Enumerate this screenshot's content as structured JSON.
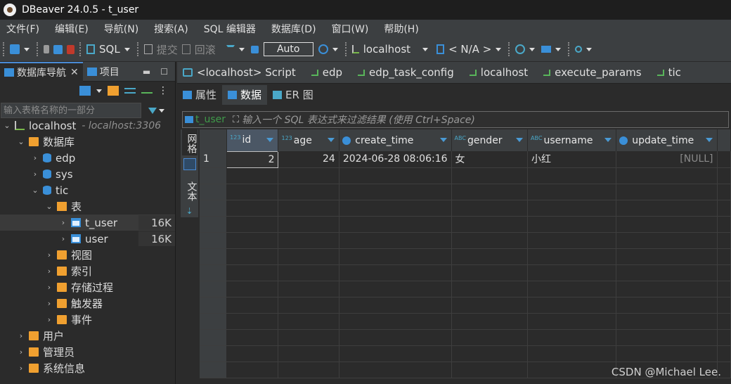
{
  "window": {
    "title": "DBeaver 24.0.5 - t_user"
  },
  "menu": [
    "文件(F)",
    "编辑(E)",
    "导航(N)",
    "搜索(A)",
    "SQL 编辑器",
    "数据库(D)",
    "窗口(W)",
    "帮助(H)"
  ],
  "toolbar": {
    "sql_label": "SQL",
    "commit_label": "提交",
    "rollback_label": "回滚",
    "transaction_mode": "Auto",
    "datasource": "localhost",
    "schema": "< N/A >"
  },
  "left_panel": {
    "tabs": [
      {
        "label": "数据库导航",
        "active": true
      },
      {
        "label": "项目",
        "active": false
      }
    ],
    "filter_placeholder": "输入表格名称的一部分",
    "tree": {
      "connection": {
        "label": "localhost",
        "detail": "- localhost:3306"
      },
      "databases_folder": "数据库",
      "databases": [
        "edp",
        "sys",
        "tic"
      ],
      "tables_folder": "表",
      "tables": [
        {
          "name": "t_user",
          "size": "16K",
          "selected": true
        },
        {
          "name": "user",
          "size": "16K",
          "selected": false
        }
      ],
      "tic_folders": [
        "视图",
        "索引",
        "存储过程",
        "触发器",
        "事件"
      ],
      "root_folders": [
        "用户",
        "管理员",
        "系统信息"
      ]
    }
  },
  "editor_tabs": [
    "<localhost> Script",
    "edp",
    "edp_task_config",
    "localhost",
    "execute_params",
    "tic"
  ],
  "sub_tabs": [
    {
      "label": "属性",
      "active": false
    },
    {
      "label": "数据",
      "active": true
    },
    {
      "label": "ER 图",
      "active": false
    }
  ],
  "filter": {
    "table_name": "t_user",
    "hint": "输入一个 SQL 表达式来过滤结果 (使用 Ctrl+Space)"
  },
  "side_toolbar": {
    "grid_label": "网格",
    "text_label": "文本"
  },
  "grid": {
    "columns": [
      {
        "name": "id",
        "type_icon": "123"
      },
      {
        "name": "age",
        "type_icon": "123"
      },
      {
        "name": "create_time",
        "type_icon": "clock"
      },
      {
        "name": "gender",
        "type_icon": "ABC"
      },
      {
        "name": "username",
        "type_icon": "ABC"
      },
      {
        "name": "update_time",
        "type_icon": "clock"
      }
    ],
    "rows": [
      {
        "row_number": "1",
        "id": "2",
        "age": "24",
        "create_time": "2024-06-28 08:06:16",
        "gender": "女",
        "username": "小红",
        "update_time": "[NULL]"
      }
    ]
  },
  "watermark": "CSDN @Michael Lee."
}
